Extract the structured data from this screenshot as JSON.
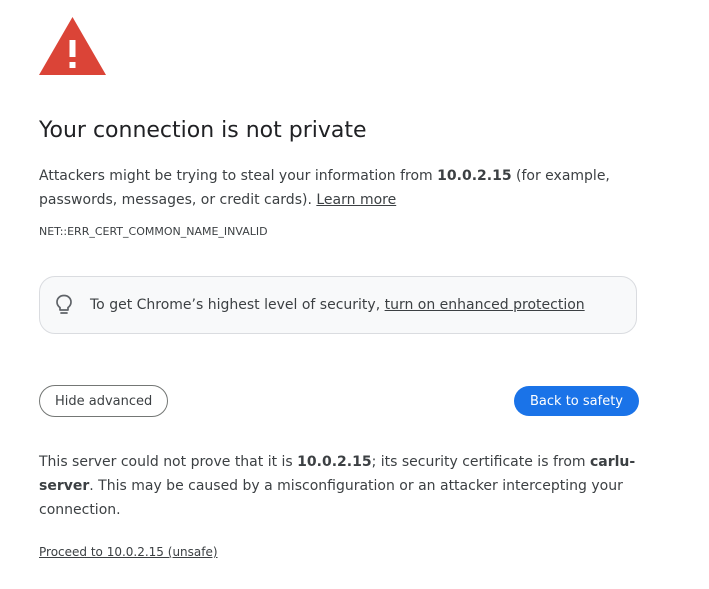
{
  "colors": {
    "warning_red": "#db4437",
    "primary_blue": "#1a73e8",
    "text": "#202124",
    "secondary_text": "#3c4043"
  },
  "icons": {
    "warning": "warning-triangle-icon",
    "promo": "lightbulb-icon"
  },
  "heading": "Your connection is not private",
  "explanation": {
    "text_before": "Attackers might be trying to steal your information from ",
    "host": "10.0.2.15",
    "text_after": " (for example, passwords, messages, or credit cards). ",
    "learn_more": "Learn more"
  },
  "error_code": "NET::ERR_CERT_COMMON_NAME_INVALID",
  "promo": {
    "text": "To get Chrome’s highest level of security, ",
    "link": "turn on enhanced protection"
  },
  "buttons": {
    "hide_advanced": "Hide advanced",
    "back_to_safety": "Back to safety"
  },
  "details": {
    "text_1": "This server could not prove that it is ",
    "host": "10.0.2.15",
    "text_2": "; its security certificate is from ",
    "issuer": "carlu-server",
    "text_3": ". This may be caused by a misconfiguration or an attacker intercepting your connection."
  },
  "proceed_link": "Proceed to 10.0.2.15 (unsafe)"
}
